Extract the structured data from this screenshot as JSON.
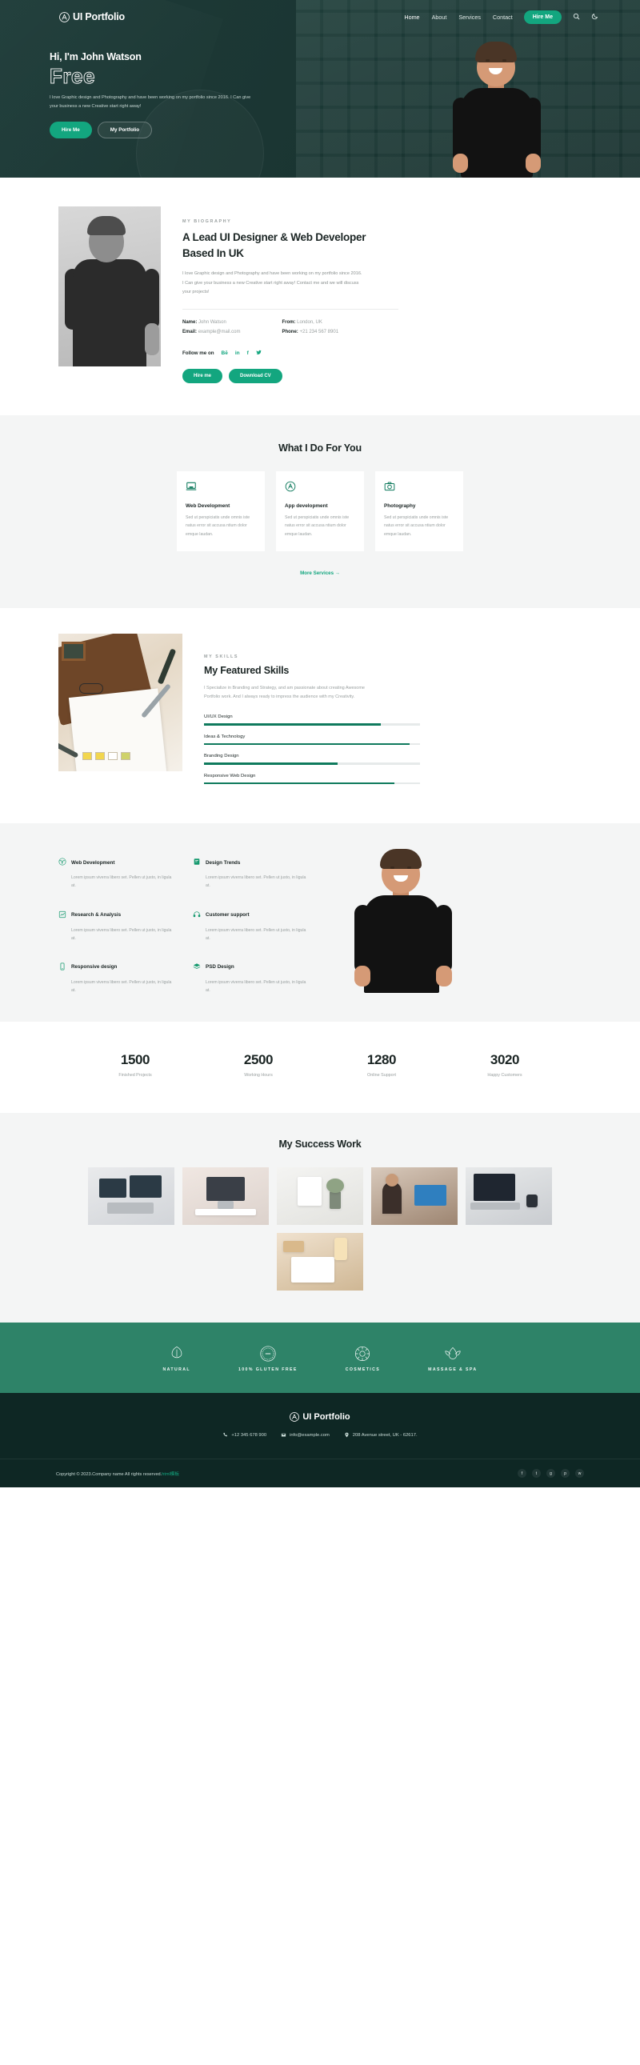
{
  "brand": {
    "name": "UI Portfolio",
    "mark_icon": "monogram-a-icon"
  },
  "nav": {
    "links": [
      {
        "label": "Home"
      },
      {
        "label": "About"
      },
      {
        "label": "Services"
      },
      {
        "label": "Contact"
      }
    ],
    "hire_label": "Hire Me",
    "search_icon": "search-icon",
    "theme_icon": "moon-icon"
  },
  "hero": {
    "greeting": "Hi, I'm John Watson",
    "outline_word": "Free",
    "description": "I love Graphic design and Photography and have been working on my portfolio since 2016. I Can give your business a new Creative start right away!",
    "primary_btn": "Hire Me",
    "secondary_btn": "My Portfolio"
  },
  "biography": {
    "eyebrow": "MY BIOGRAPHY",
    "heading": "A Lead UI Designer & Web Developer Based In UK",
    "paragraph": "I love Graphic design and Photography and have been working on my portfolio since 2016. I Can give your business a new Creative start right away! Contact me and we will discuss your projects!",
    "fields": [
      {
        "label": "Name:",
        "value": "John Watson"
      },
      {
        "label": "Email:",
        "value": "example@mail.com"
      },
      {
        "label": "From:",
        "value": "London, UK"
      },
      {
        "label": "Phone:",
        "value": "+21 234 567 8901"
      }
    ],
    "follow_label": "Follow me on",
    "socials": [
      {
        "label": "Bē",
        "name": "behance-icon"
      },
      {
        "label": "in",
        "name": "linkedin-icon"
      },
      {
        "label": "f",
        "name": "facebook-icon"
      },
      {
        "label": "🐦",
        "name": "twitter-icon"
      }
    ],
    "hire_btn": "Hire me",
    "cv_btn": "Download CV"
  },
  "services": {
    "title": "What I Do For You",
    "cards": [
      {
        "icon": "laptop-icon",
        "title": "Web Development",
        "text": "Sed ut perspiciatis unde omnis iste natus error sit accusa ntium dolor emque laudan."
      },
      {
        "icon": "app-store-icon",
        "title": "App development",
        "text": "Sed ut perspiciatis unde omnis iste natus error sit accusa ntium dolor emque laudan."
      },
      {
        "icon": "camera-icon",
        "title": "Photography",
        "text": "Sed ut perspiciatis unde omnis iste natus error sit accusa ntium dolor emque laudan."
      }
    ],
    "more_label": "More Services →"
  },
  "skills": {
    "eyebrow": "MY SKILLS",
    "heading": "My Featured Skills",
    "paragraph": "I Specialize in Branding and Strategy, and am passionate about creating Awesome Portfolio work. And I always ready to impress the audience with my Creativity.",
    "bars": [
      {
        "label": "UI/UX Design",
        "percent": 82
      },
      {
        "label": "Ideas & Technology",
        "percent": 95
      },
      {
        "label": "Branding Design",
        "percent": 62
      },
      {
        "label": "Responsive Web Design",
        "percent": 88
      }
    ]
  },
  "features": {
    "items": [
      {
        "icon": "wordpress-icon",
        "title": "Web Development",
        "text": "Lorem ipsum viverra libero set. Pellen ut justo, in ligula at."
      },
      {
        "icon": "trends-icon",
        "title": "Design Trends",
        "text": "Lorem ipsum viverra libero set. Pellen ut justo, in ligula at."
      },
      {
        "icon": "chart-icon",
        "title": "Research & Analysis",
        "text": "Lorem ipsum viverra libero set. Pellen ut justo, in ligula at."
      },
      {
        "icon": "headset-icon",
        "title": "Customer support",
        "text": "Lorem ipsum viverra libero set. Pellen ut justo, in ligula at."
      },
      {
        "icon": "mobile-icon",
        "title": "Responsive design",
        "text": "Lorem ipsum viverra libero set. Pellen ut justo, in ligula at."
      },
      {
        "icon": "layers-icon",
        "title": "PSD Design",
        "text": "Lorem ipsum viverra libero set. Pellen ut justo, in ligula at."
      }
    ]
  },
  "counters": [
    {
      "number": "1500",
      "label": "Finished Projects"
    },
    {
      "number": "2500",
      "label": "Working Hours"
    },
    {
      "number": "1280",
      "label": "Online Support"
    },
    {
      "number": "3020",
      "label": "Happy Customers"
    }
  ],
  "portfolio": {
    "title": "My Success Work",
    "items": [
      {
        "name": "desk-with-monitors"
      },
      {
        "name": "desk-with-imac"
      },
      {
        "name": "shelf-with-vase"
      },
      {
        "name": "woman-at-desk"
      },
      {
        "name": "laptop-and-watch"
      },
      {
        "name": "hands-writing-notebook"
      }
    ]
  },
  "badges": [
    {
      "icon": "leaf-badge-icon",
      "label": "NATURAL"
    },
    {
      "icon": "gluten-free-badge-icon",
      "label": "100% GLUTEN FREE"
    },
    {
      "icon": "cosmetics-badge-icon",
      "label": "COSMETICS"
    },
    {
      "icon": "massage-spa-badge-icon",
      "label": "MASSAGE & SPA"
    }
  ],
  "footer": {
    "brand": "UI Portfolio",
    "contacts": [
      {
        "icon": "phone-icon",
        "text": "+12 345 678 900"
      },
      {
        "icon": "mail-icon",
        "text": "info@example.com"
      },
      {
        "icon": "location-icon",
        "text": "208 Avenue street, UK - 62617."
      }
    ],
    "copyright": "Copyright © 2023.Company name All rights reserved.",
    "copyright_link": "html模板",
    "socials": [
      {
        "label": "f",
        "name": "facebook-icon"
      },
      {
        "label": "t",
        "name": "twitter-icon"
      },
      {
        "label": "g",
        "name": "google-icon"
      },
      {
        "label": "p",
        "name": "pinterest-icon"
      },
      {
        "label": "w",
        "name": "vk-icon"
      }
    ]
  },
  "colors": {
    "accent": "#13a67f",
    "dark": "#0e2724",
    "badge_band": "#2e8368"
  }
}
